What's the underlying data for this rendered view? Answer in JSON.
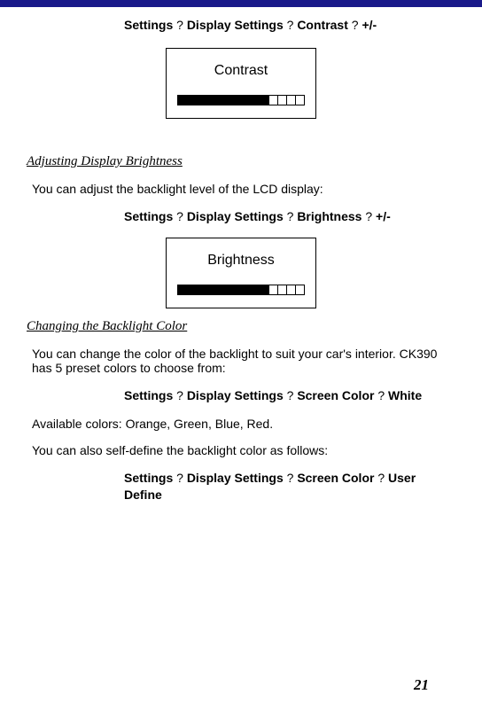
{
  "nav1": {
    "p1": "Settings",
    "s1": "?",
    "p2": "Display Settings",
    "s2": "?",
    "p3": "Contrast",
    "s3": "?",
    "p4": "+/-"
  },
  "box1": {
    "title": "Contrast"
  },
  "sec1": {
    "heading": "Adjusting Display Brightness",
    "text": "You can adjust the backlight level of the LCD display:",
    "nav": {
      "p1": "Settings",
      "s1": "?",
      "p2": "Display Settings",
      "s2": "?",
      "p3": "Brightness",
      "s3": "?",
      "p4": "+/-"
    }
  },
  "box2": {
    "title": "Brightness"
  },
  "sec2": {
    "heading": "Changing the Backlight Color",
    "text1": "You can change the color of the backlight to suit your car's interior. CK390 has 5 preset colors to choose from:",
    "nav1": {
      "p1": "Settings",
      "s1": "?",
      "p2": "Display Settings",
      "s2": "?",
      "p3": "Screen Color",
      "s3": "?",
      "p4": "White"
    },
    "text2": "Available colors: Orange, Green, Blue, Red.",
    "text3": "You can also self-define the backlight color as follows:",
    "nav2": {
      "p1": "Settings",
      "s1": "?",
      "p2": "Display Settings",
      "s2": "?",
      "p3": "Screen Color",
      "s3": "?",
      "p4": "User Define"
    }
  },
  "page_number": "21"
}
